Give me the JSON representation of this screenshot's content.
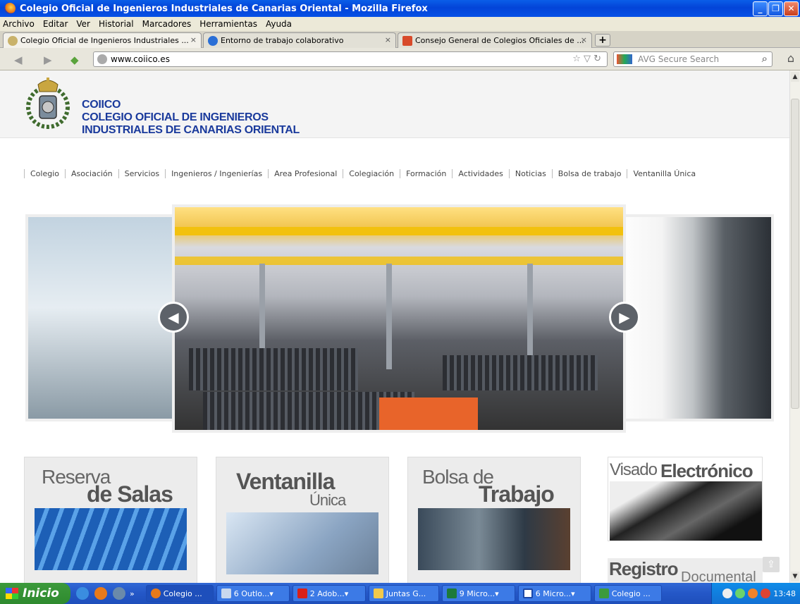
{
  "window": {
    "title": "Colegio Oficial de Ingenieros Industriales de Canarias Oriental - Mozilla Firefox"
  },
  "menu": [
    "Archivo",
    "Editar",
    "Ver",
    "Historial",
    "Marcadores",
    "Herramientas",
    "Ayuda"
  ],
  "tabs": [
    {
      "label": "Colegio Oficial de Ingenieros Industriales ...",
      "active": true
    },
    {
      "label": "Entorno de trabajo colaborativo",
      "active": false
    },
    {
      "label": "Consejo General de Colegios Oficiales de ...",
      "active": false
    }
  ],
  "address": {
    "url": "www.coiico.es"
  },
  "search": {
    "placeholder": "AVG Secure Search"
  },
  "site": {
    "brand_short": "COIICO",
    "brand_line1": "COLEGIO OFICIAL DE INGENIEROS",
    "brand_line2": "INDUSTRIALES DE CANARIAS ORIENTAL",
    "nav": [
      "Colegio",
      "Asociación",
      "Servicios",
      "Ingenieros / Ingenierías",
      "Area Profesional",
      "Colegiación",
      "Formación",
      "Actividades",
      "Noticias",
      "Bolsa de trabajo",
      "Ventanilla Única"
    ],
    "cards": [
      {
        "line1": "Reserva",
        "line2": "de Salas"
      },
      {
        "line1": "Ventanilla",
        "line2": "Única"
      },
      {
        "line1": "Bolsa de",
        "line2": "Trabajo"
      },
      {
        "line1": "Visado",
        "line2": "Electrónico"
      }
    ],
    "registro": {
      "line1": "Registro",
      "line2": "Documental"
    }
  },
  "taskbar": {
    "start": "Inicio",
    "buttons": [
      "Colegio ...",
      "6 Outlo...",
      "2 Adob...",
      "Juntas G...",
      "9 Micro...",
      "6 Micro...",
      "Colegio ..."
    ],
    "clock": "13:48"
  },
  "colors": {
    "brand": "#1a3a9c",
    "xp_blue": "#0a5ee8",
    "start_green": "#3c9a3c"
  }
}
